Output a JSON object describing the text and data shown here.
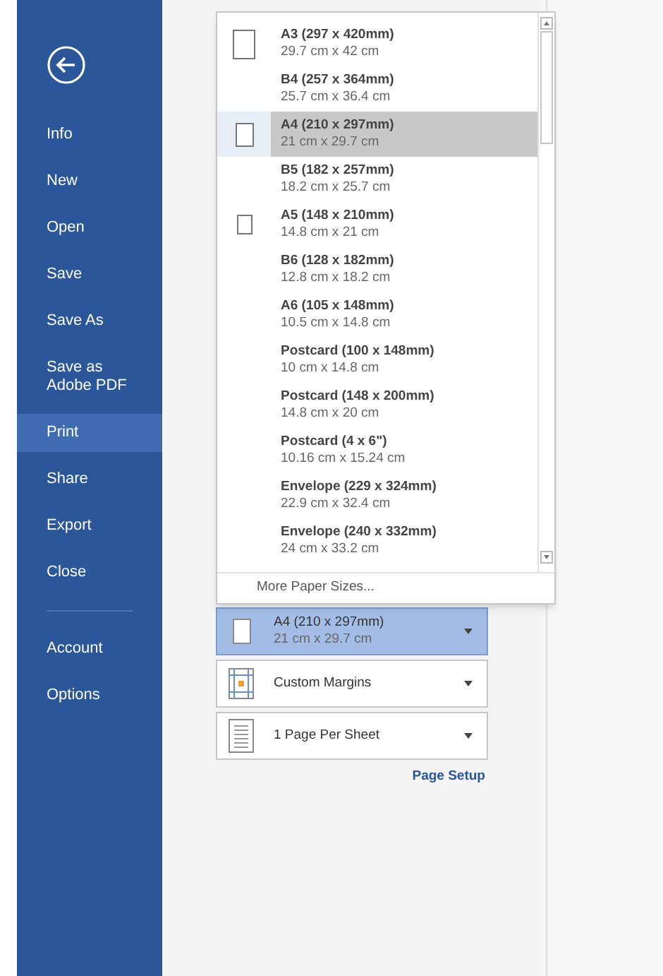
{
  "sidebar": {
    "items": [
      {
        "label": "Info",
        "selected": false
      },
      {
        "label": "New",
        "selected": false
      },
      {
        "label": "Open",
        "selected": false
      },
      {
        "label": "Save",
        "selected": false
      },
      {
        "label": "Save As",
        "selected": false
      },
      {
        "label": "Save as Adobe PDF",
        "selected": false
      },
      {
        "label": "Print",
        "selected": true
      },
      {
        "label": "Share",
        "selected": false
      },
      {
        "label": "Export",
        "selected": false
      },
      {
        "label": "Close",
        "selected": false
      }
    ],
    "bottom_items": [
      {
        "label": "Account",
        "selected": false
      },
      {
        "label": "Options",
        "selected": false
      }
    ]
  },
  "paper_menu": {
    "items": [
      {
        "name": "A3 (297 x 420mm)",
        "size": "29.7 cm x 42 cm",
        "kind": "large",
        "selected": false
      },
      {
        "name": "B4 (257 x 364mm)",
        "size": "25.7 cm x 36.4 cm",
        "selected": false
      },
      {
        "name": "A4 (210 x 297mm)",
        "size": "21 cm x 29.7 cm",
        "kind": "medium",
        "selected": true
      },
      {
        "name": "B5 (182 x 257mm)",
        "size": "18.2 cm x 25.7 cm",
        "selected": false
      },
      {
        "name": "A5 (148 x 210mm)",
        "size": "14.8 cm x 21 cm",
        "kind": "small",
        "selected": false
      },
      {
        "name": "B6 (128 x 182mm)",
        "size": "12.8 cm x 18.2 cm",
        "selected": false
      },
      {
        "name": "A6 (105 x 148mm)",
        "size": "10.5 cm x 14.8 cm",
        "selected": false
      },
      {
        "name": "Postcard (100 x 148mm)",
        "size": "10 cm x 14.8 cm",
        "selected": false
      },
      {
        "name": "Postcard (148 x 200mm)",
        "size": "14.8 cm x 20 cm",
        "selected": false
      },
      {
        "name": "Postcard (4 x 6\")",
        "size": "10.16 cm x 15.24 cm",
        "selected": false
      },
      {
        "name": "Envelope (229 x 324mm)",
        "size": "22.9 cm x 32.4 cm",
        "selected": false
      },
      {
        "name": "Envelope (240 x 332mm)",
        "size": "24 cm x 33.2 cm",
        "selected": false
      }
    ],
    "more": "More Paper Sizes..."
  },
  "settings": [
    {
      "kind": "paper",
      "label": "A4 (210 x 297mm)",
      "sub": "21 cm x 29.7 cm",
      "selected": true
    },
    {
      "kind": "margins",
      "label": "Custom Margins",
      "selected": false
    },
    {
      "kind": "pages",
      "label": "1 Page Per Sheet",
      "selected": false
    }
  ],
  "page_setup": "Page Setup"
}
